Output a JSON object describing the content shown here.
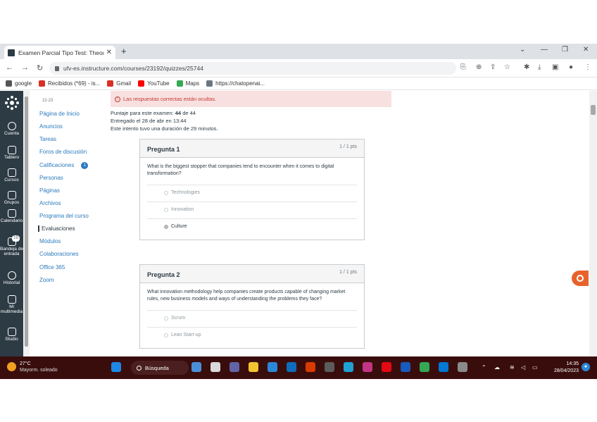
{
  "browser": {
    "tab_title": "Examen Parcial Tipo Test: Theory",
    "tab_close": "✕",
    "new_tab": "+",
    "url": "ufv-es.instructure.com/courses/23192/quizzes/25744",
    "window_controls": [
      "⌄",
      "—",
      "❐",
      "✕"
    ],
    "bookmarks": [
      {
        "label": "google",
        "color": "#555555"
      },
      {
        "label": "Recibidos (*69) - is...",
        "color": "#d93025"
      },
      {
        "label": "Gmail",
        "color": "#d93025"
      },
      {
        "label": "YouTube",
        "color": "#ff0000"
      },
      {
        "label": "Maps",
        "color": "#34a853"
      },
      {
        "label": "https://chatopenai...",
        "color": "#6b7780"
      }
    ]
  },
  "global_nav": {
    "items": [
      {
        "label": "Cuenta"
      },
      {
        "label": "Tablero"
      },
      {
        "label": "Cursos"
      },
      {
        "label": "Grupos"
      },
      {
        "label": "Calendario"
      },
      {
        "label": "Bandeja de entrada"
      },
      {
        "label": "Historial"
      },
      {
        "label": "Mi multimedia"
      },
      {
        "label": "Studio"
      }
    ],
    "inbox_badge": "10"
  },
  "course_nav": {
    "term": "22-23",
    "items": [
      {
        "label": "Página de Inicio"
      },
      {
        "label": "Anuncios"
      },
      {
        "label": "Tareas"
      },
      {
        "label": "Foros de discusión"
      },
      {
        "label": "Calificaciones",
        "badge": "1"
      },
      {
        "label": "Personas"
      },
      {
        "label": "Páginas"
      },
      {
        "label": "Archivos"
      },
      {
        "label": "Programa del curso"
      },
      {
        "label": "Evaluaciones",
        "active": true
      },
      {
        "label": "Módulos"
      },
      {
        "label": "Colaboraciones"
      },
      {
        "label": "Office 365"
      },
      {
        "label": "Zoom"
      }
    ]
  },
  "quiz": {
    "alert": "Las respuestas correctas están ocultas.",
    "score_prefix": "Puntaje para este examen:",
    "score_value": "44",
    "score_suffix": "de 44",
    "submitted": "Entregado el 28 de abr en 13:44",
    "duration": "Este intento tuvo una duración de 29 minutos.",
    "questions": [
      {
        "title": "Pregunta 1",
        "points": "1 / 1 pts",
        "text": "What is the biggest stopper that companies tend to encounter when it comes to digital transformation?",
        "answers": [
          {
            "label": "Technologies",
            "selected": false
          },
          {
            "label": "Innovation",
            "selected": false
          },
          {
            "label": "Culture",
            "selected": true
          }
        ]
      },
      {
        "title": "Pregunta 2",
        "points": "1 / 1 pts",
        "text": "What innovation methodology help companies create products capable of changing market rules, new business models and ways of understanding the problems they face?",
        "answers": [
          {
            "label": "Scrum",
            "selected": false
          },
          {
            "label": "Lean Start-up",
            "selected": false
          }
        ]
      }
    ]
  },
  "taskbar": {
    "weather_temp": "27°C",
    "weather_desc": "Mayorm. soleado",
    "search_label": "Búsqueda",
    "time": "14:35",
    "date": "28/04/2023",
    "apps": [
      {
        "name": "task-view-icon",
        "color": "#4a90d9"
      },
      {
        "name": "files-icon",
        "color": "#d9d9d9"
      },
      {
        "name": "chat-icon",
        "color": "#6264a7"
      },
      {
        "name": "explorer-icon",
        "color": "#f4c430"
      },
      {
        "name": "calendar-app-icon",
        "color": "#2b88d8"
      },
      {
        "name": "mail-icon",
        "color": "#0f6cbd"
      },
      {
        "name": "media-icon",
        "color": "#d83b01"
      },
      {
        "name": "store-icon",
        "color": "#5c5c5c"
      },
      {
        "name": "edge-icon",
        "color": "#1fa1d3"
      },
      {
        "name": "instagram-icon",
        "color": "#c13584"
      },
      {
        "name": "netflix-icon",
        "color": "#e50914"
      },
      {
        "name": "word-icon",
        "color": "#185abd"
      },
      {
        "name": "chrome-icon",
        "color": "#34a853"
      },
      {
        "name": "photos-icon",
        "color": "#0078d4"
      },
      {
        "name": "app-icon",
        "color": "#8a8a8a"
      }
    ]
  }
}
